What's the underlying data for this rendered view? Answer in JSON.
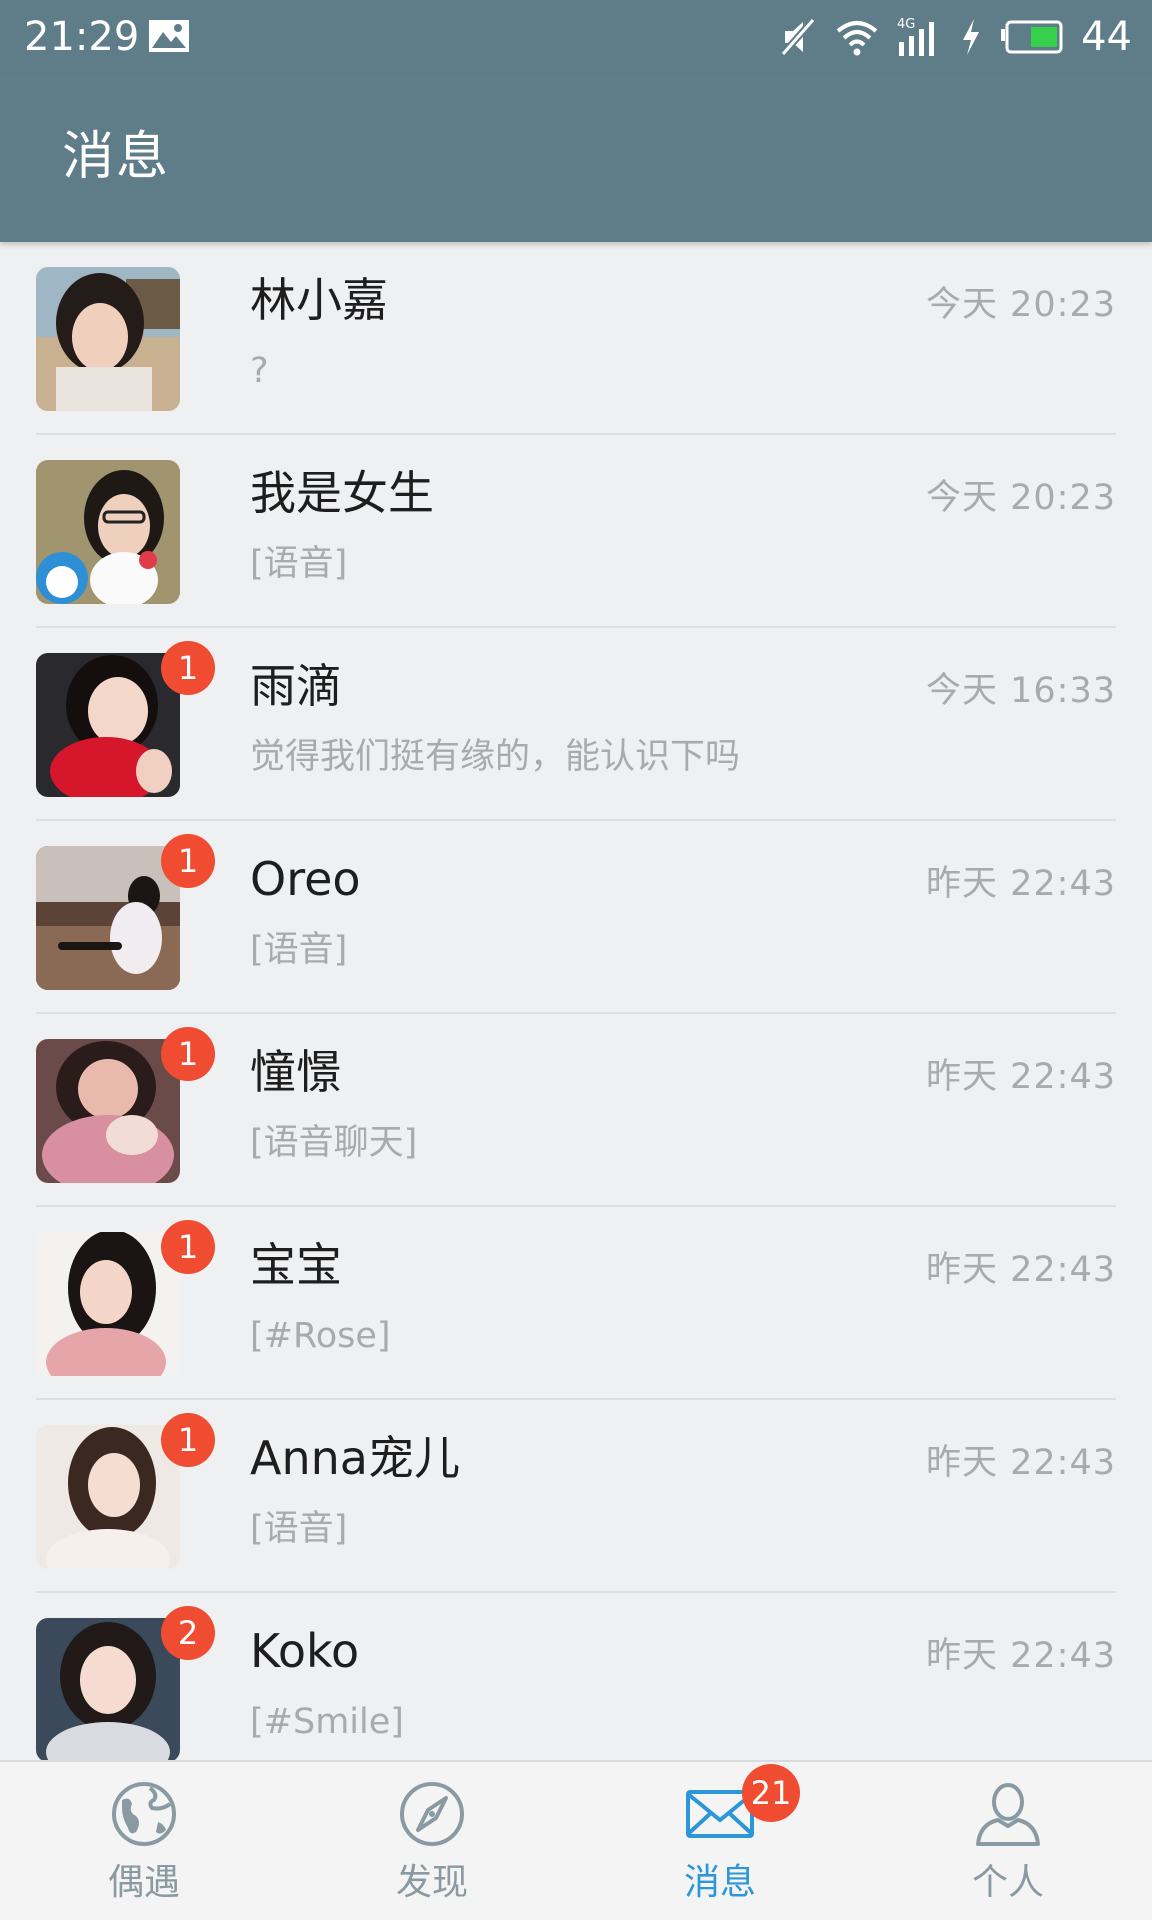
{
  "status_bar": {
    "time": "21:29",
    "icons": [
      "image-icon",
      "muted-icon",
      "wifi-icon",
      "signal-4g-icon",
      "charging-icon",
      "battery-icon"
    ],
    "signal_label": "4G",
    "battery_level": "44"
  },
  "header": {
    "title": "消息"
  },
  "conversations": [
    {
      "name": "林小嘉",
      "preview": "?",
      "time": "今天 20:23",
      "badge": ""
    },
    {
      "name": "我是女生",
      "preview": "[语音]",
      "time": "今天 20:23",
      "badge": ""
    },
    {
      "name": "雨滴",
      "preview": "觉得我们挺有缘的，能认识下吗",
      "time": "今天 16:33",
      "badge": "1"
    },
    {
      "name": "Oreo",
      "preview": "[语音]",
      "time": "昨天 22:43",
      "badge": "1"
    },
    {
      "name": "憧憬",
      "preview": "[语音聊天]",
      "time": "昨天 22:43",
      "badge": "1"
    },
    {
      "name": "宝宝",
      "preview": "[#Rose]",
      "time": "昨天 22:43",
      "badge": "1"
    },
    {
      "name": "Anna宠儿",
      "preview": "[语音]",
      "time": "昨天 22:43",
      "badge": "1"
    },
    {
      "name": "Koko",
      "preview": "[#Smile]",
      "time": "昨天 22:43",
      "badge": "2"
    }
  ],
  "bottom_nav": {
    "items": [
      {
        "label": "偶遇",
        "icon": "globe-icon",
        "active": false
      },
      {
        "label": "发现",
        "icon": "compass-icon",
        "active": false
      },
      {
        "label": "消息",
        "icon": "mail-icon",
        "active": true,
        "badge": "21"
      },
      {
        "label": "个人",
        "icon": "person-icon",
        "active": false
      }
    ]
  },
  "colors": {
    "header_bg": "#5f7c89",
    "badge": "#ef4c31",
    "active_tab": "#2c97d8",
    "inactive_tab": "#8a9aa2",
    "page_bg": "#eff0f1"
  }
}
